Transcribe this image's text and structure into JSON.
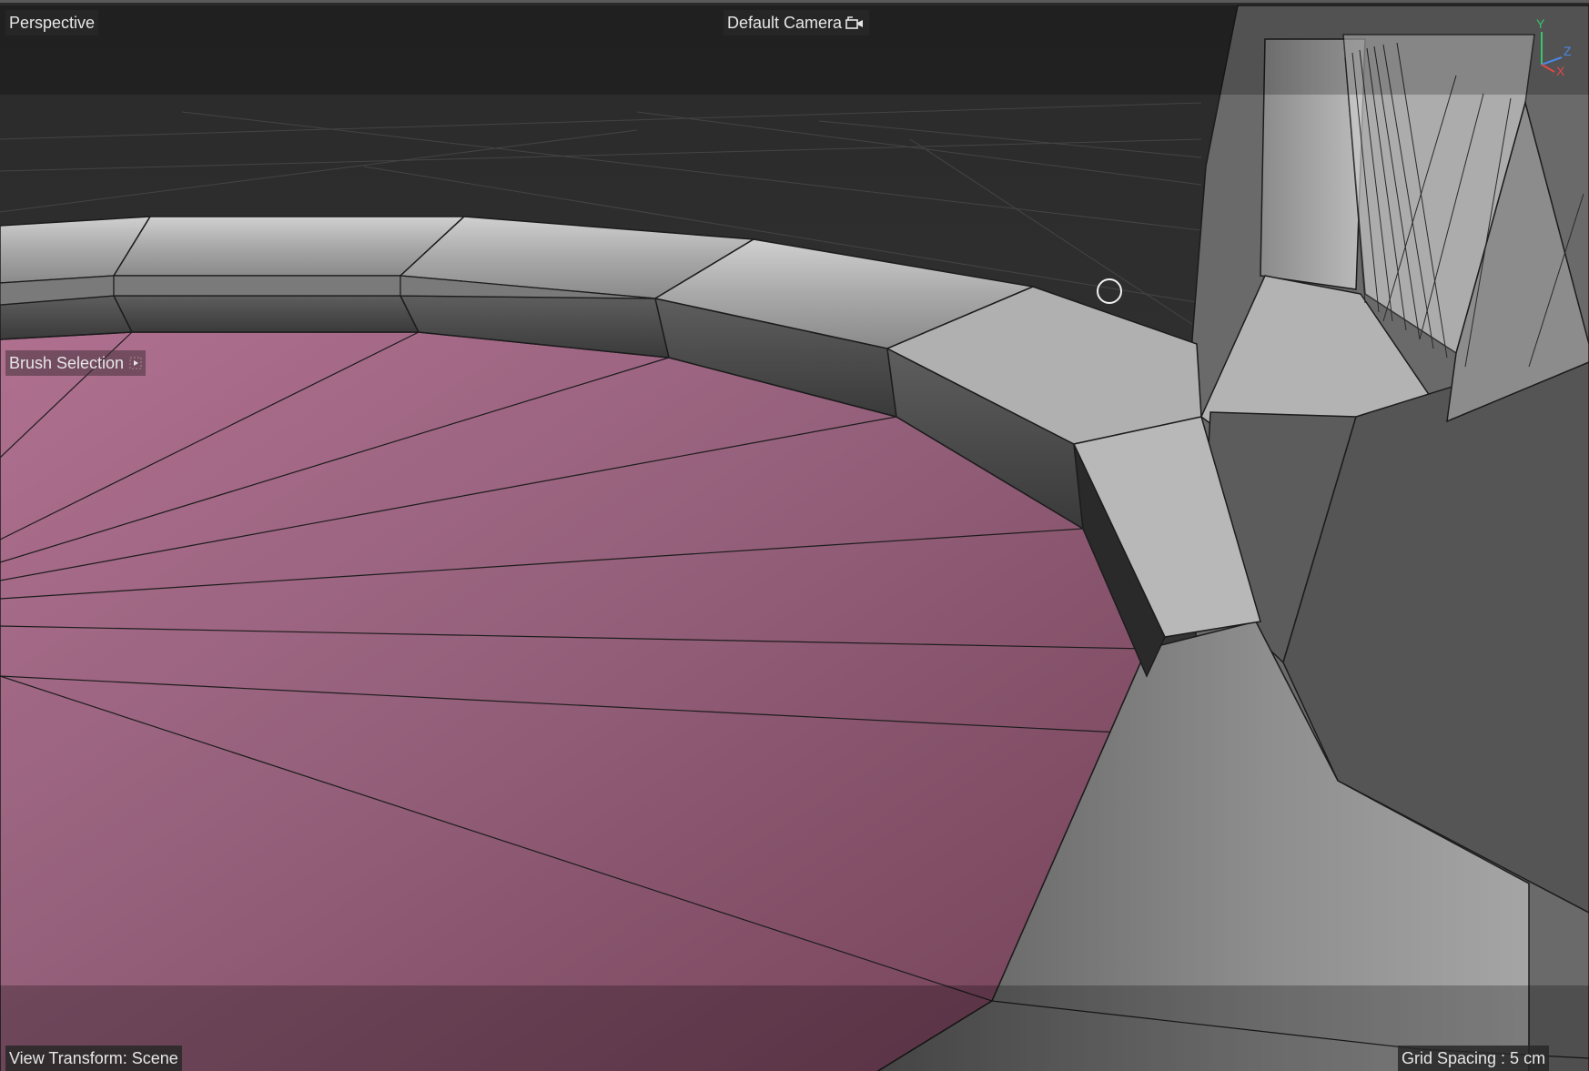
{
  "viewport": {
    "view_name": "Perspective",
    "camera_label": "Default Camera",
    "brush_label": "Brush Selection",
    "view_transform": "View Transform: Scene",
    "grid_spacing": "Grid Spacing : 5 cm"
  },
  "axes": {
    "y": "Y",
    "z": "Z",
    "x": "X"
  },
  "colors": {
    "background": "#3a3a3a",
    "selection": "#a8607c",
    "mesh_light": "#b5b5b5",
    "mesh_mid": "#8e8e8e",
    "mesh_dark": "#4a4a4a",
    "axis_y": "#38c46a",
    "axis_z": "#4b86e6",
    "axis_x": "#e04848"
  }
}
